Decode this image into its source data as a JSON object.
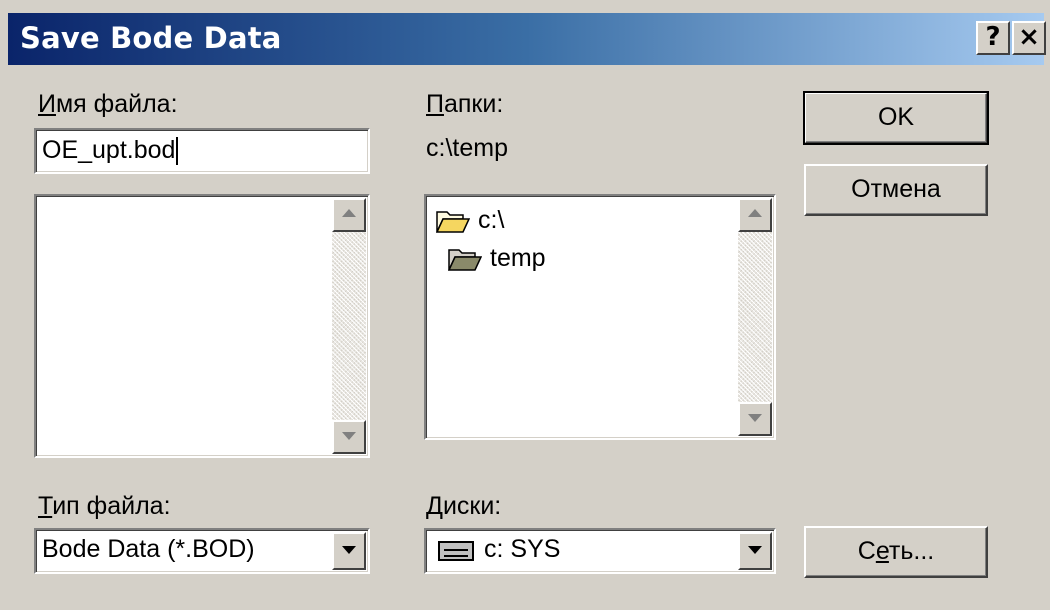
{
  "window": {
    "title": "Save Bode Data"
  },
  "titlebar": {
    "help_label": "?",
    "close_label": "×"
  },
  "filename": {
    "label_accel": "И",
    "label_rest": "мя файла:",
    "value": "OE_upt.bod"
  },
  "folders": {
    "label_accel": "П",
    "label_rest": "апки:",
    "current_path": "c:\\temp",
    "tree": [
      {
        "label": "c:\\",
        "icon": "open-folder-icon"
      },
      {
        "label": "temp",
        "icon": "open-folder-icon"
      }
    ]
  },
  "filetype": {
    "label_accel": "Т",
    "label_rest": "ип файла:",
    "selected": "Bode Data (*.BOD)"
  },
  "drives": {
    "label_accel": "Д",
    "label_rest": "иски:",
    "selected": "c: SYS",
    "icon": "drive-icon"
  },
  "buttons": {
    "ok_label": "OK",
    "cancel_label": "Отмена",
    "network_before": "С",
    "network_accel": "е",
    "network_after": "ть..."
  },
  "colors": {
    "face": "#d4d0c8",
    "title_start": "#0a246a",
    "title_end": "#a6caf0"
  }
}
